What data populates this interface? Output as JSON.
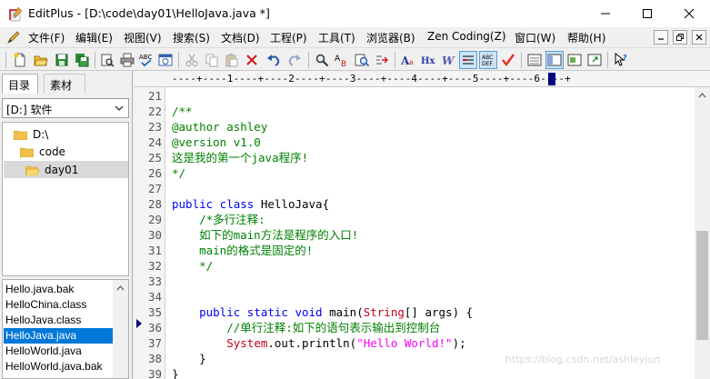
{
  "window": {
    "title": "EditPlus - [D:\\code\\day01\\HelloJava.java *]"
  },
  "menu": {
    "items": [
      "文件(F)",
      "编辑(E)",
      "视图(V)",
      "搜索(S)",
      "文档(D)",
      "工程(P)",
      "工具(T)",
      "浏览器(B)",
      "Zen Coding(Z)",
      "窗口(W)",
      "帮助(H)"
    ]
  },
  "left_panel": {
    "tabs": [
      "目录",
      "素材"
    ],
    "drive": "[D:] 软件",
    "tree": [
      "D:\\",
      "code",
      "day01"
    ],
    "files": [
      "Hello.java.bak",
      "HelloChina.class",
      "HelloJava.class",
      "HelloJava.java",
      "HelloWorld.java",
      "HelloWorld.java.bak"
    ],
    "selected_file_index": 3
  },
  "editor": {
    "ruler": "----+----1----+----2----+----3----+----4----+----5----+----6----+",
    "line_numbers": [
      "21",
      "22",
      "23",
      "24",
      "25",
      "26",
      "27",
      "28",
      "29",
      "30",
      "31",
      "32",
      "33",
      "34",
      "35",
      "36",
      "37",
      "38",
      "39"
    ],
    "lines": {
      "l22": "/**",
      "l23": "@author ashley",
      "l24": "@version v1.0",
      "l25": "这是我的第一个java程序!",
      "l26": "*/",
      "l28_kw": "public class",
      "l28_rest": " HelloJava{",
      "l29": "    /*多行注释:",
      "l30": "    如下的main方法是程序的入口!",
      "l31": "    main的格式是固定的!",
      "l32": "    */",
      "l35_indent": "    ",
      "l35_kw": "public static void",
      "l35_a": " main(",
      "l35_type": "String",
      "l35_b": "[] args) {",
      "l36": "        //单行注释:如下的语句表示输出到控制台",
      "l37_indent": "        ",
      "l37_type": "System",
      "l37_a": ".out.println(",
      "l37_str": "\"Hello World!\"",
      "l37_b": ");",
      "l38": "    }",
      "l39": "}"
    },
    "watermark": "https://blog.csdn.net/ashleyjun"
  }
}
